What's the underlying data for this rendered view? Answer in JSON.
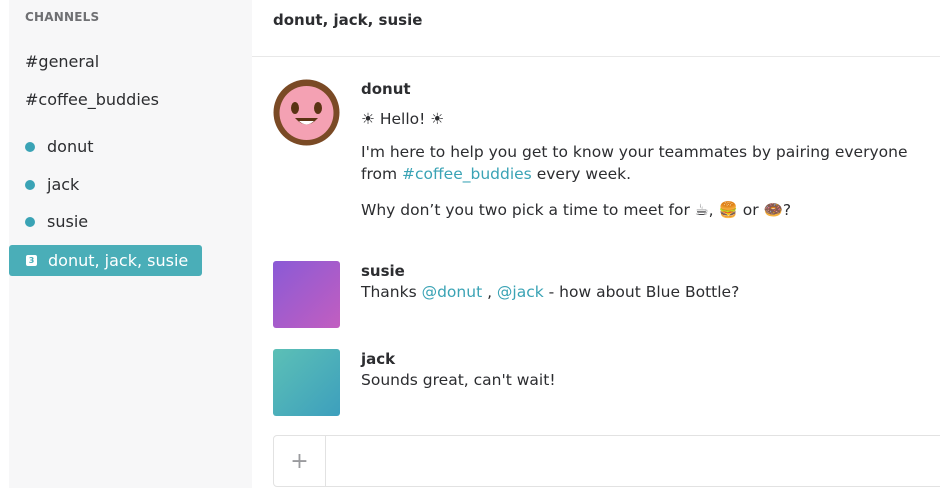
{
  "sidebar": {
    "heading": "CHANNELS",
    "channels": [
      {
        "label": "#general"
      },
      {
        "label": "#coffee_buddies"
      }
    ],
    "direct_messages": [
      {
        "label": "donut"
      },
      {
        "label": "jack"
      },
      {
        "label": "susie"
      }
    ],
    "active_group": {
      "badge": "3",
      "label": "donut, jack, susie"
    }
  },
  "header": {
    "title": "donut, jack, susie"
  },
  "messages": [
    {
      "author": "donut",
      "lines": {
        "greeting": "☀ Hello! ☀",
        "intro_1": "I'm here to help you get to know your teammates by pairing everyone",
        "intro_2_prefix": "from ",
        "intro_2_link": "#coffee_buddies",
        "intro_2_suffix": " every week.",
        "question_prefix": "Why don’t you two pick a time to meet for ",
        "question_emoji_1": "☕",
        "question_sep_1": ", ",
        "question_emoji_2": "🍔",
        "question_sep_2": " or ",
        "question_emoji_3": "🍩",
        "question_suffix": "?"
      }
    },
    {
      "author": "susie",
      "lines": {
        "prefix": "Thanks ",
        "mention_1": "@donut",
        "sep": " , ",
        "mention_2": "@jack",
        "suffix": " - how about Blue Bottle?"
      }
    },
    {
      "author": "jack",
      "lines": {
        "text": "Sounds great, can't wait!"
      }
    }
  ],
  "composer": {
    "plus_label": "+",
    "placeholder": ""
  },
  "colors": {
    "accent": "#4aaeb8",
    "link": "#3aa3b5",
    "status_dot": "#3aa3b5",
    "susie_avatar_start": "#8a5ad6",
    "susie_avatar_end": "#c25ec0",
    "jack_avatar_start": "#5cc0b6",
    "jack_avatar_end": "#3d9fbd"
  }
}
